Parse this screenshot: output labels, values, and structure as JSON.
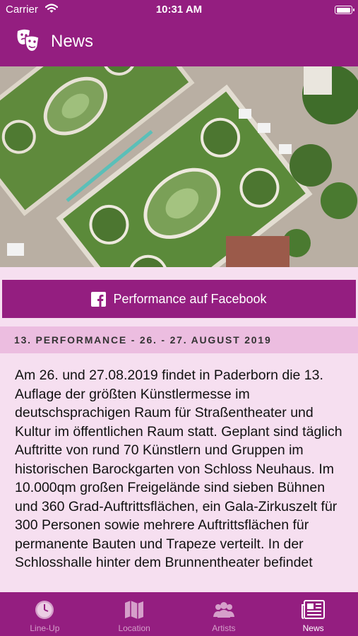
{
  "status_bar": {
    "carrier": "Carrier",
    "time": "10:31 AM"
  },
  "nav": {
    "title": "News",
    "icon": "theater-masks-icon"
  },
  "hero": {
    "description_icon": "aerial-garden-photo"
  },
  "facebook_button": {
    "label": "Performance auf Facebook",
    "icon": "facebook-icon"
  },
  "section": {
    "header": "13. PERFORMANCE - 26. - 27. AUGUST 2019"
  },
  "article": {
    "body": "Am 26. und 27.08.2019 findet in Paderborn die 13. Auflage der größten Künstlermesse im deutschsprachigen Raum für Straßentheater und Kultur im öffentlichen Raum statt. Geplant sind täglich Auftritte von rund 70 Künstlern und Gruppen im historischen Barockgarten von Schloss Neuhaus. Im 10.000qm großen Freigelände sind sieben Bühnen und 360 Grad-Auftrittsflächen, ein Gala-Zirkuszelt für 300 Personen sowie mehrere Auftrittsflächen für permanente Bauten und Trapeze verteilt. In der Schlosshalle hinter dem Brunnentheater befindet"
  },
  "tabs": [
    {
      "label": "Line-Up",
      "icon": "clock-icon",
      "active": false
    },
    {
      "label": "Location",
      "icon": "map-icon",
      "active": false
    },
    {
      "label": "Artists",
      "icon": "people-icon",
      "active": false
    },
    {
      "label": "News",
      "icon": "newspaper-icon",
      "active": true
    }
  ],
  "colors": {
    "primary": "#941e80",
    "background": "#f6dff0",
    "section_header": "#ecbde0",
    "tab_inactive": "#d59fca"
  }
}
